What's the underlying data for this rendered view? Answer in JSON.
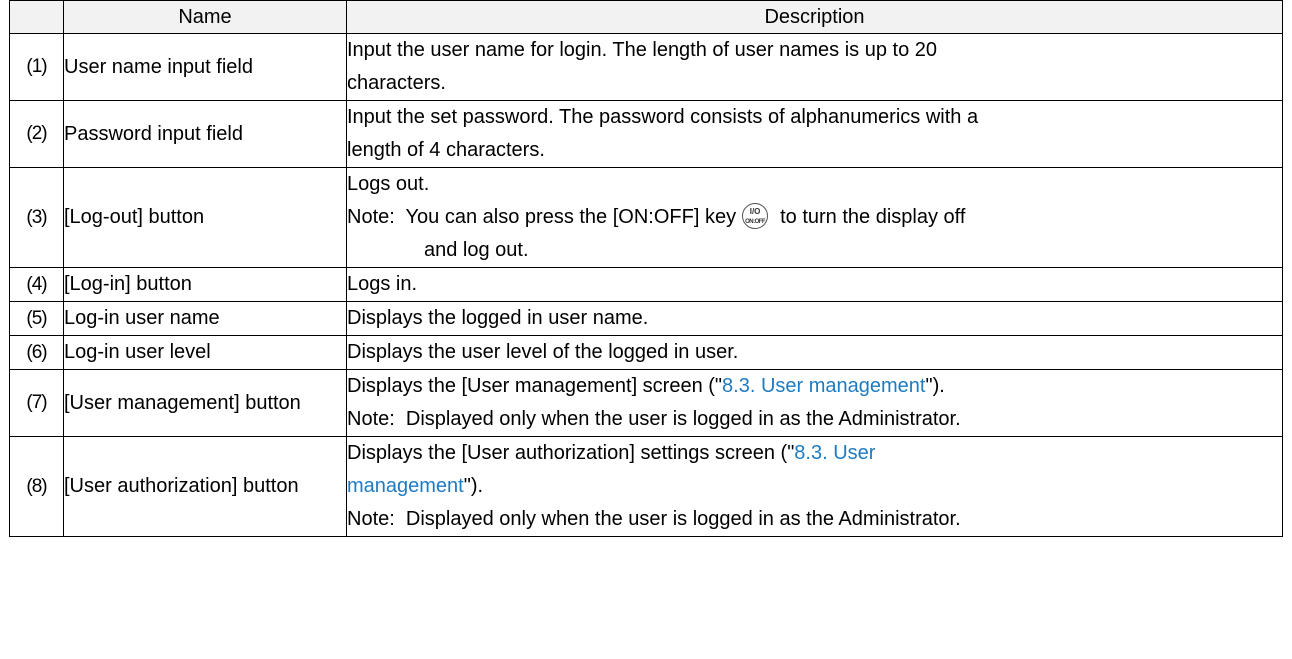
{
  "header": {
    "num": "",
    "name": "Name",
    "description": "Description"
  },
  "rows": [
    {
      "num": "(1)",
      "name": "User name input field",
      "desc": [
        "Input the user name for login. The length of user names is up to 20",
        "characters."
      ]
    },
    {
      "num": "(2)",
      "name": "Password input field",
      "desc": [
        "Input the set password. The password consists of alphanumerics with a",
        "length of 4 characters."
      ]
    },
    {
      "num": "(3)",
      "name": "[Log-out] button",
      "desc_line1": "Logs out.",
      "note_before_icon": "Note:  You can also press the [ON:OFF] key",
      "icon_text_top": "I/O",
      "icon_text_bottom": "ON:OFF",
      "note_after_icon": "to turn the display off",
      "note_cont": "and log out."
    },
    {
      "num": "(4)",
      "name": "[Log-in] button",
      "desc": [
        "Logs in."
      ]
    },
    {
      "num": "(5)",
      "name": "Log-in user name",
      "desc": [
        "Displays the logged in user name."
      ]
    },
    {
      "num": "(6)",
      "name": "Log-in user level",
      "desc": [
        "Displays the user level of the logged in user."
      ]
    },
    {
      "num": "(7)",
      "name": "[User management] button",
      "line1_before": "Displays the [User management] screen (\"",
      "line1_link": "8.3. User management",
      "line1_after": "\").",
      "note": "Note:  Displayed only when the user is logged in as the Administrator."
    },
    {
      "num": "(8)",
      "name": "[User authorization] button",
      "line1_before": "Displays the [User authorization] settings screen (\"",
      "line1_link": "8.3. User",
      "line2_link": "management",
      "line2_after": "\").",
      "note": "Note:  Displayed only when the user is logged in as the Administrator."
    }
  ],
  "colors": {
    "link": "#1f7bc1",
    "header_bg": "#f2f2f2"
  },
  "icons": {
    "power_key": "on-off-key-icon"
  }
}
